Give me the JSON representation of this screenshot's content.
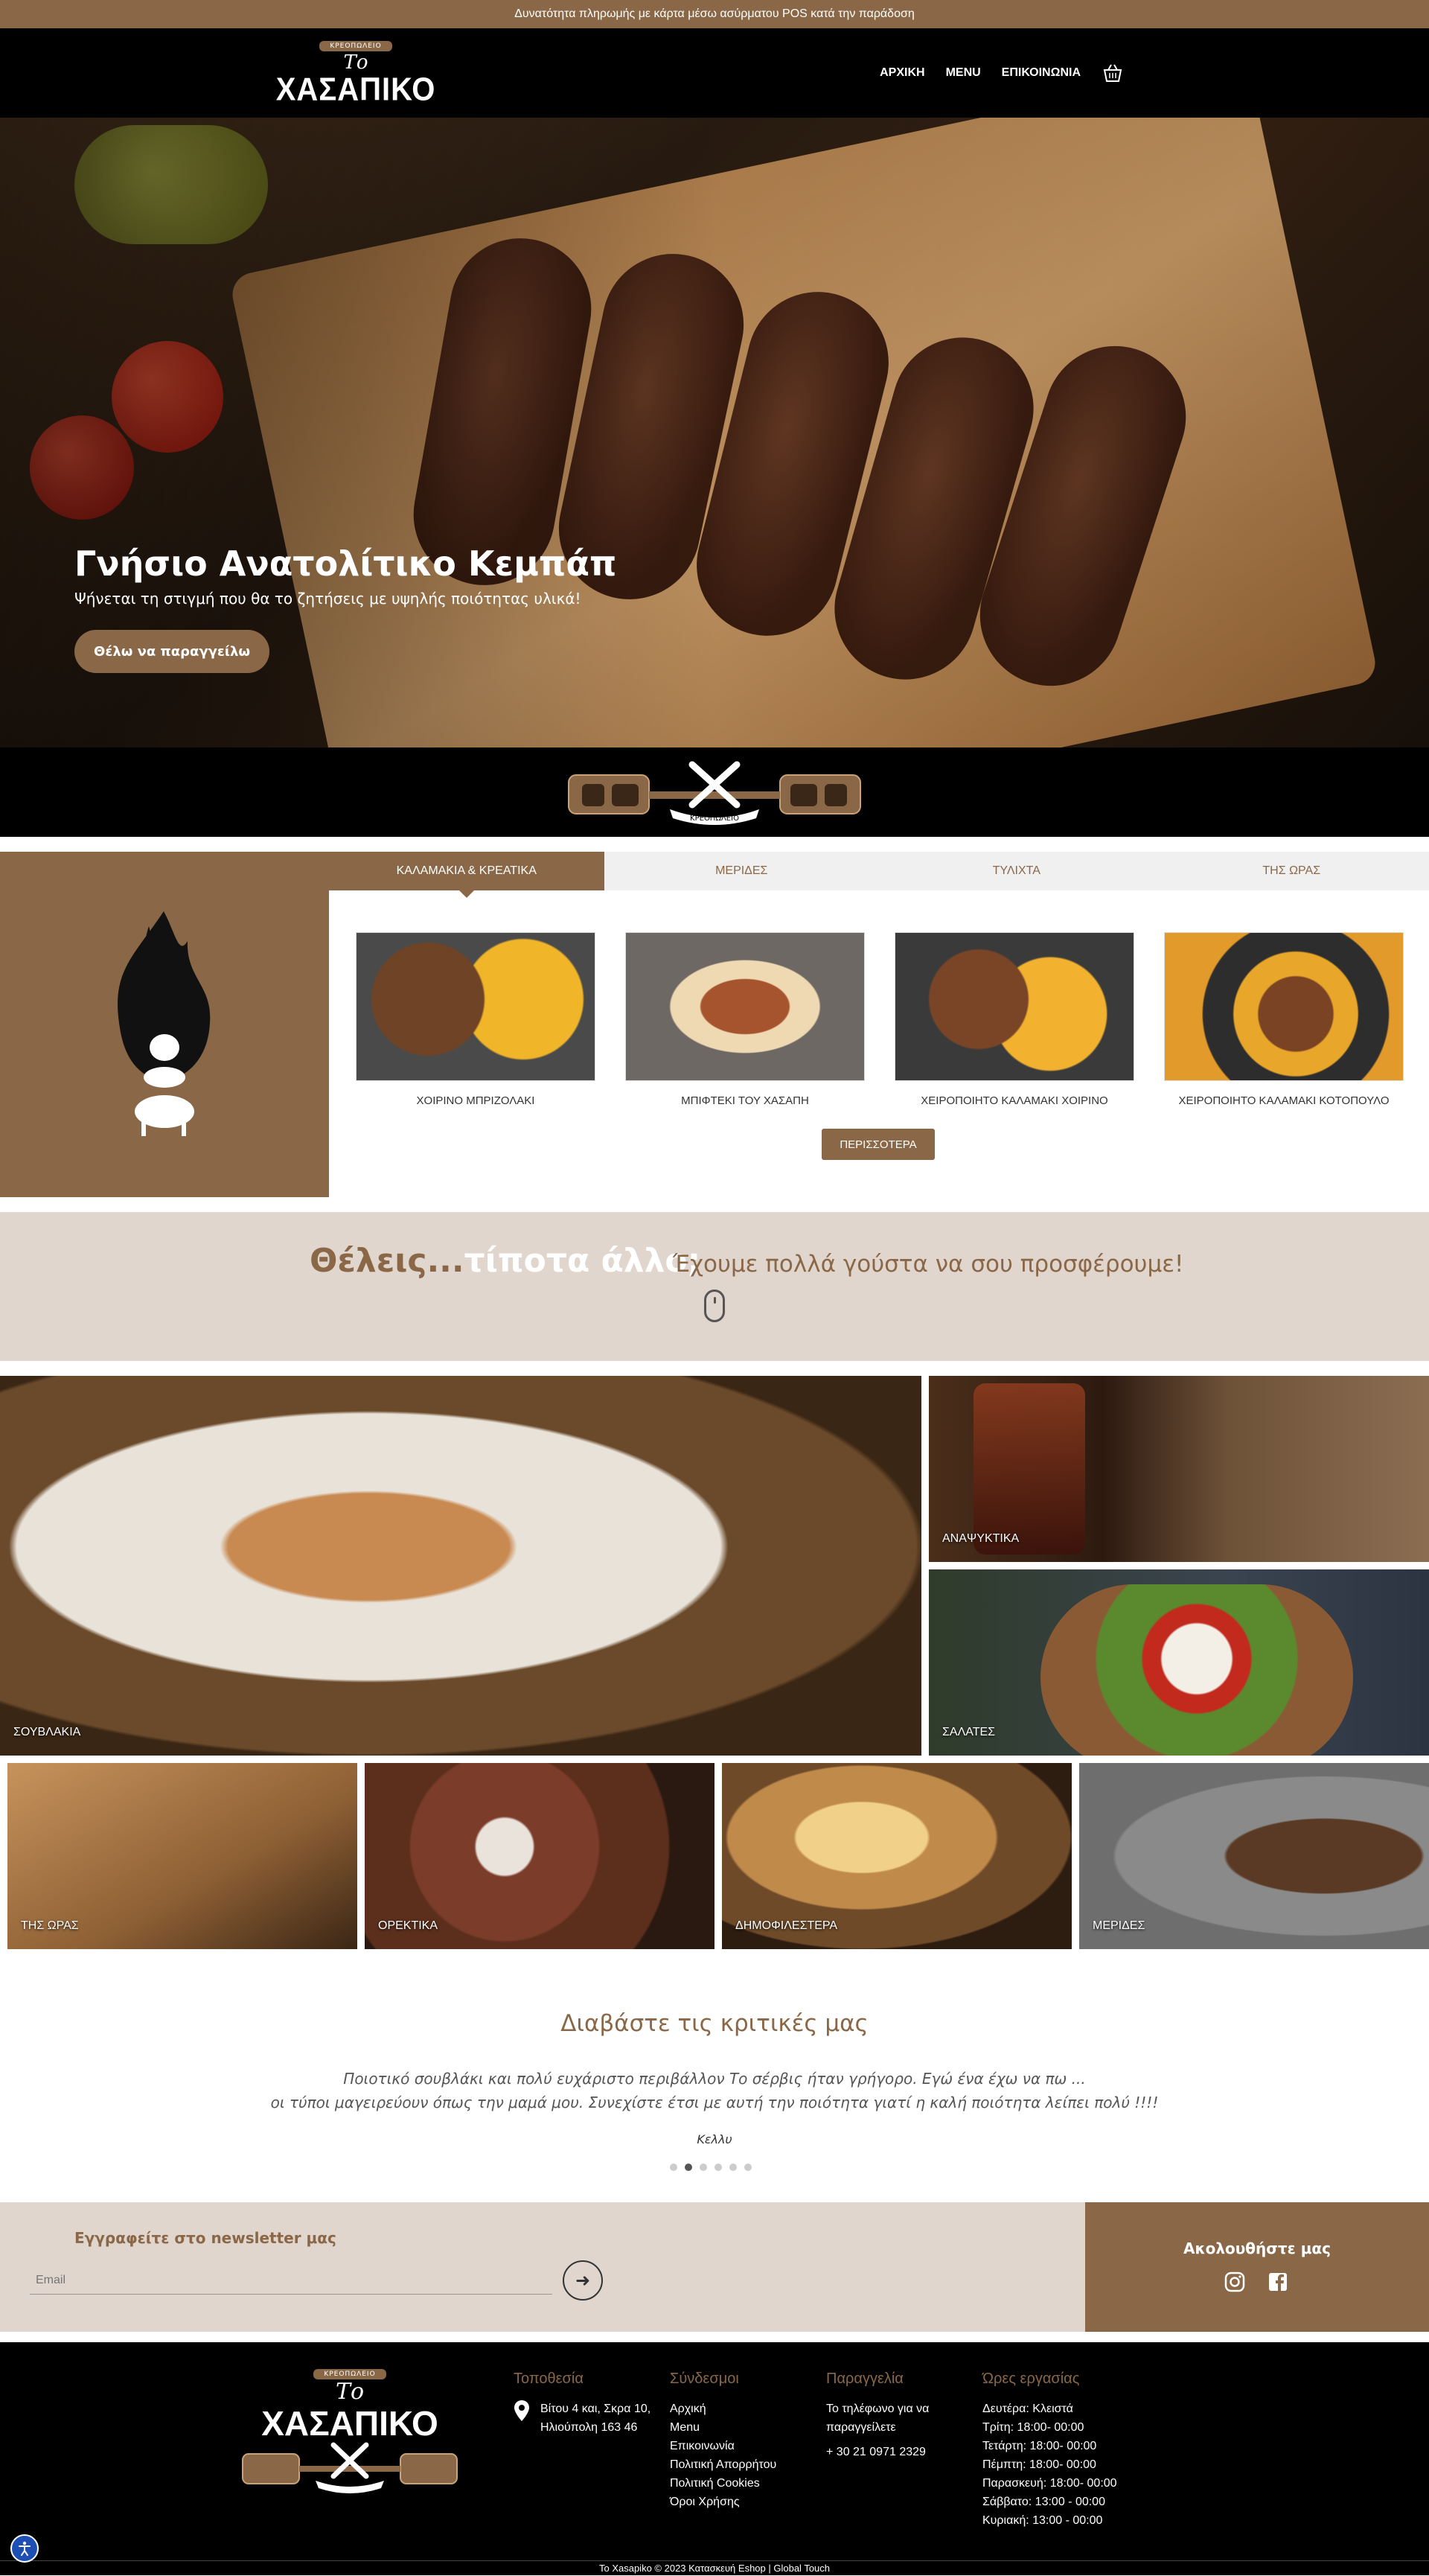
{
  "topbar": {
    "text": "Δυνατότητα πληρωμής με κάρτα μέσω ασύρματου POS κατά την παράδοση"
  },
  "brand": {
    "ribbon": "ΚΡΕΟΠΩΛΕΙΟ",
    "to": "Το",
    "name": "ΧΑΣΑΠΙΚΟ",
    "color": "#8a6847"
  },
  "nav": {
    "items": [
      "ΑΡΧΙΚΗ",
      "MENU",
      "ΕΠΙΚΟΙΝΩΝΙΑ"
    ],
    "cart_icon": "basket-icon"
  },
  "hero": {
    "title": "Γνήσιο Ανατολίτικο Κεμπάπ",
    "subtitle": "Ψήνεται τη στιγμή που θα το ζητήσεις με υψηλής ποιότητας υλικά!",
    "button": "Θέλω να παραγγείλω"
  },
  "emblem": {
    "ribbon": "ΚΡΕΟΠΩΛΕΙΟ"
  },
  "categories": {
    "tabs": [
      "ΚΑΛΑΜΑΚΙΑ & ΚΡΕΑΤΙΚΑ",
      "ΜΕΡΙΔΕΣ",
      "ΤΥΛΙΧΤΑ",
      "ΤΗΣ ΩΡΑΣ"
    ],
    "active_tab": "ΚΑΛΑΜΑΚΙΑ & ΚΡΕΑΤΙΚΑ",
    "products": [
      "ΧΟΙΡΙΝΟ ΜΠΡΙΖΟΛΑΚΙ",
      "ΜΠΙΦΤΕΚΙ ΤΟΥ ΧΑΣΑΠΗ",
      "ΧΕΙΡΟΠΟΙΗΤΟ ΚΑΛΑΜΑΚΙ ΧΟΙΡΙΝΟ",
      "ΧΕΙΡΟΠΟΙΗΤΟ ΚΑΛΑΜΑΚΙ ΚΟΤΟΠΟΥΛΟ"
    ],
    "more_button": "ΠΕΡΙΣΣΟΤΕΡΑ"
  },
  "want": {
    "question_a": "Θέλεις...",
    "question_b": "τίποτα άλλο;",
    "tagline": "Έχουμε πολλά γούστα να σου προσφέρουμε!"
  },
  "tiles": {
    "souvlakia": "ΣΟΥΒΛΑΚΙΑ",
    "anapsyktika": "ΑΝΑΨΥΚΤΙΚΑ",
    "salates": "ΣΑΛΑΤΕΣ",
    "tis_oras": "ΤΗΣ ΩΡΑΣ",
    "orektika": "ΟΡΕΚΤΙΚΑ",
    "dimofilestera": "ΔΗΜΟΦΙΛΕΣΤΕΡΑ",
    "merides": "ΜΕΡΙΔΕΣ"
  },
  "reviews": {
    "title": "Διαβάστε τις κριτικές μας",
    "line1": "Ποιοτικό σουβλάκι και πολύ ευχάριστο περιβάλλον Το σέρβις ήταν γρήγορο. Εγώ ένα έχω να πω ...",
    "line2": "οι τύποι μαγειρεύουν όπως την μαμά μου. Συνεχίστε έτσι με αυτή την ποιότητα γιατί η καλή ποιότητα λείπει πολύ !!!!",
    "author": "Κελλυ",
    "dot_count": 6,
    "active_dot": 1
  },
  "newsletter": {
    "title": "Εγγραφείτε στο newsletter μας",
    "placeholder": "Email"
  },
  "follow": {
    "title": "Ακολουθήστε μας",
    "icons": [
      "instagram-icon",
      "facebook-icon"
    ]
  },
  "footer": {
    "location": {
      "title": "Τοποθεσία",
      "line1": "Βίτου 4 και, Σκρα 10,",
      "line2": "Ηλιούπολη 163 46"
    },
    "links": {
      "title": "Σύνδεσμοι",
      "items": [
        "Αρχική",
        "Menu",
        "Επικοινωνία",
        "Πολιτική Απορρήτου",
        "Πολιτική Cookies",
        "Όροι Χρήσης"
      ]
    },
    "order": {
      "title": "Παραγγελία",
      "line1": "Το τηλέφωνο για να",
      "line2": "παραγγείλετε",
      "phone": "+ 30 21 0971 2329"
    },
    "hours": {
      "title": "Ώρες εργασίας",
      "items": [
        "Δευτέρα: Κλειστά",
        "Τρίτη: 18:00- 00:00",
        "Τετάρτη: 18:00- 00:00",
        "Πέμπτη: 18:00- 00:00",
        "Παρασκευή: 18:00- 00:00",
        "Σάββατο: 13:00 - 00:00",
        "Κυριακή: 13:00 - 00:00"
      ]
    }
  },
  "copyright": "Το Xasapiko © 2023 Κατασκευή Eshop | Global Touch"
}
